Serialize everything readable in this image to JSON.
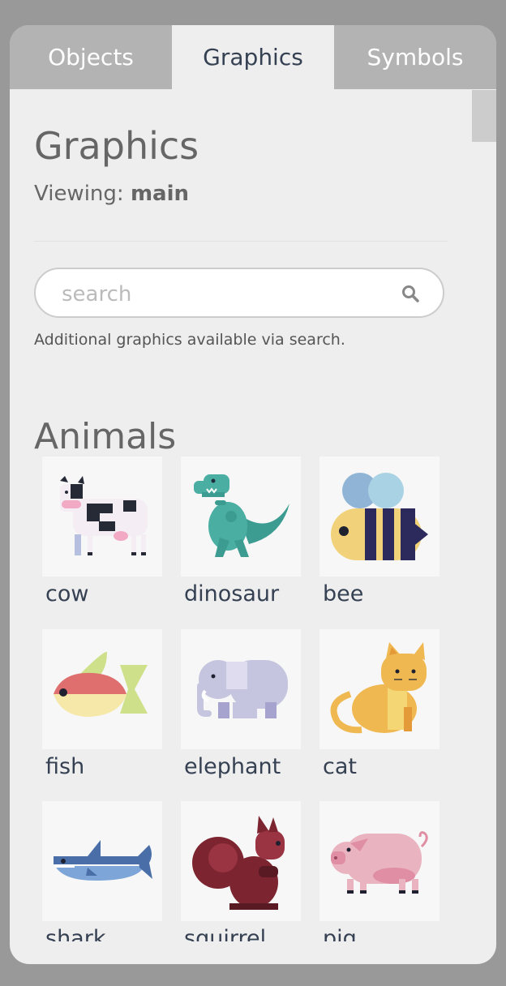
{
  "tabs": [
    {
      "label": "Objects"
    },
    {
      "label": "Graphics",
      "active": true
    },
    {
      "label": "Symbols"
    }
  ],
  "header": {
    "title": "Graphics",
    "viewing_prefix": "Viewing: ",
    "viewing_value": "main"
  },
  "search": {
    "placeholder": "search",
    "icon": "search-icon",
    "note": "Additional graphics available via search."
  },
  "section": {
    "title": "Animals",
    "items": [
      {
        "label": "cow",
        "icon": "cow-icon"
      },
      {
        "label": "dinosaur",
        "icon": "dinosaur-icon"
      },
      {
        "label": "bee",
        "icon": "bee-icon"
      },
      {
        "label": "fish",
        "icon": "fish-icon"
      },
      {
        "label": "elephant",
        "icon": "elephant-icon"
      },
      {
        "label": "cat",
        "icon": "cat-icon"
      },
      {
        "label": "shark",
        "icon": "shark-icon"
      },
      {
        "label": "squirrel",
        "icon": "squirrel-icon"
      },
      {
        "label": "pig",
        "icon": "pig-icon"
      }
    ]
  },
  "colors": {
    "tab_inactive": "#b3b3b3",
    "panel": "#eeeeee",
    "text_dark": "#354153",
    "text_muted": "#666666"
  }
}
